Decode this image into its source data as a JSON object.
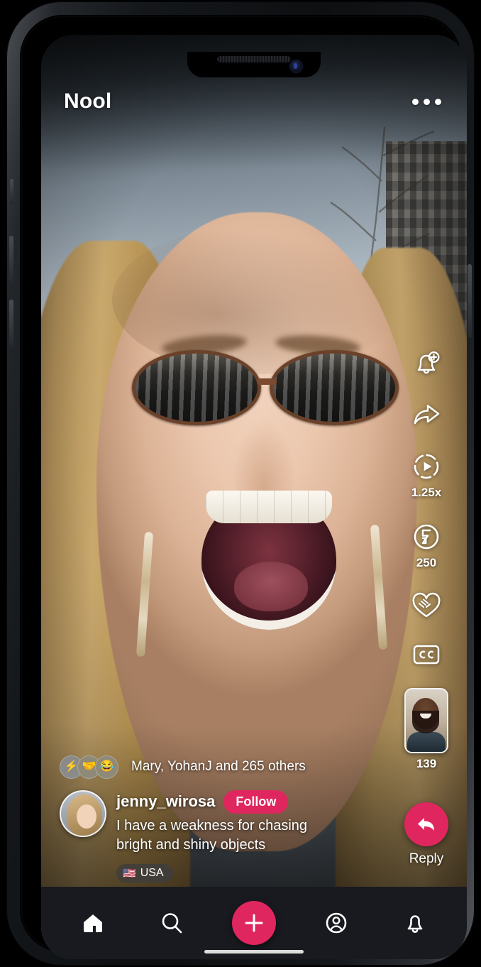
{
  "app": {
    "title": "Nool",
    "more_menu": "more-options"
  },
  "action_rail": [
    {
      "id": "notify",
      "icon": "bell-plus-icon",
      "label": ""
    },
    {
      "id": "share",
      "icon": "share-arrow-icon",
      "label": ""
    },
    {
      "id": "speed",
      "icon": "playback-speed-icon",
      "label": "1.25x"
    },
    {
      "id": "flash",
      "icon": "flash-circle-icon",
      "label": "250"
    },
    {
      "id": "support",
      "icon": "heart-handshake-icon",
      "label": ""
    },
    {
      "id": "captions",
      "icon": "closed-captions-icon",
      "label": "CC"
    },
    {
      "id": "replies",
      "icon": "video-thumbnail",
      "label": "139"
    }
  ],
  "reply": {
    "label": "Reply",
    "icon": "reply-arrow-icon"
  },
  "reactions": {
    "emojis": [
      "⚡",
      "🤝",
      "😂"
    ],
    "summary": "Mary, YohanJ and 265 others"
  },
  "post": {
    "username": "jenny_wirosa",
    "follow_label": "Follow",
    "caption": "I have a weakness for chasing bright and shiny objects",
    "location_flag": "🇺🇸",
    "location": "USA",
    "avatar": "user-avatar"
  },
  "bottom_nav": [
    {
      "id": "home",
      "icon": "home-icon",
      "active": true
    },
    {
      "id": "search",
      "icon": "search-icon",
      "active": false
    },
    {
      "id": "create",
      "icon": "plus-icon",
      "active": false
    },
    {
      "id": "profile",
      "icon": "profile-icon",
      "active": false
    },
    {
      "id": "notifications",
      "icon": "bell-icon",
      "active": false
    }
  ],
  "colors": {
    "accent_pink": "#E0265F",
    "nav_bg": "#191A1F",
    "text_white": "#FFFFFF"
  }
}
